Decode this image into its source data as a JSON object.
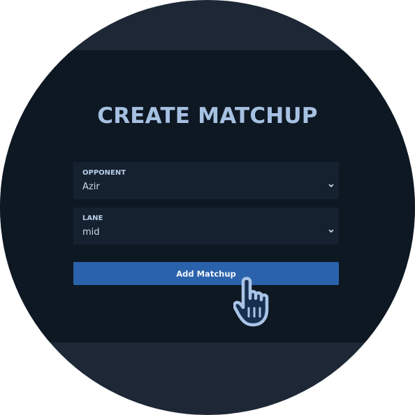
{
  "page": {
    "title": "CREATE MATCHUP"
  },
  "form": {
    "opponent": {
      "label": "OPPONENT",
      "value": "Azir"
    },
    "lane": {
      "label": "LANE",
      "value": "mid"
    },
    "submit_label": "Add Matchup"
  },
  "icons": {
    "dropdown": "chevron-down-icon",
    "cursor": "hand-pointer-icon"
  },
  "colors": {
    "background": "#0e1823",
    "title": "#a6c1e2",
    "field": "#162130",
    "button": "#2a62ac"
  }
}
